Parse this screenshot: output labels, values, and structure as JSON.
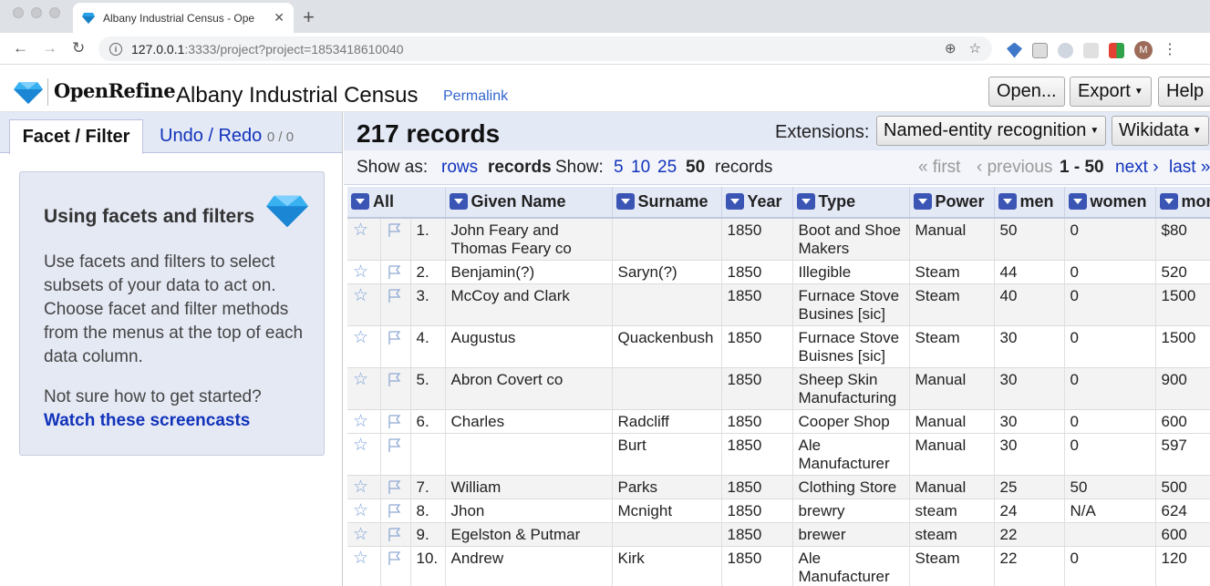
{
  "browser": {
    "tab_title": "Albany Industrial Census - Ope",
    "url_host": "127.0.0.1",
    "url_rest": ":3333/project?project=1853418610040",
    "avatar_letter": "M"
  },
  "header": {
    "logo": "OpenRefine",
    "project_title": "Albany Industrial Census",
    "permalink": "Permalink",
    "open_label": "Open...",
    "export_label": "Export",
    "help_label": "Help"
  },
  "left": {
    "tab_facet": "Facet / Filter",
    "tab_undo": "Undo / Redo",
    "undo_count": "0 / 0",
    "help_title": "Using facets and filters",
    "help_text": "Use facets and filters to select subsets of your data to act on. Choose facet and filter methods from the menus at the top of each data column.",
    "help_question": "Not sure how to get started?",
    "help_link": "Watch these screencasts"
  },
  "right": {
    "record_count": "217 records",
    "extensions_label": "Extensions:",
    "ext_ner": "Named-entity recognition",
    "ext_wikidata": "Wikidata",
    "show_as": "Show as:",
    "rows": "rows",
    "records": "records",
    "show": "Show:",
    "page_sizes": [
      "5",
      "10",
      "25",
      "50"
    ],
    "records_word": "records",
    "first": "« first",
    "previous": "‹ previous",
    "range": "1 - 50",
    "next": "next ›",
    "last": "last »"
  },
  "table": {
    "columns": [
      "All",
      "Given Name",
      "Surname",
      "Year",
      "Type",
      "Power",
      "men",
      "women",
      "mon"
    ],
    "rows": [
      {
        "idx": "1.",
        "given": "John Feary and Thomas Feary co",
        "surname": "",
        "year": "1850",
        "type": "Boot and Shoe Makers",
        "power": "Manual",
        "men": "50",
        "women": "0",
        "money": "$80"
      },
      {
        "idx": "2.",
        "given": "Benjamin(?)",
        "surname": "Saryn(?)",
        "year": "1850",
        "type": "Illegible",
        "power": "Steam",
        "men": "44",
        "women": "0",
        "money": "520"
      },
      {
        "idx": "3.",
        "given": "McCoy and Clark",
        "surname": "",
        "year": "1850",
        "type": "Furnace Stove Busines [sic]",
        "power": "Steam",
        "men": "40",
        "women": "0",
        "money": "1500"
      },
      {
        "idx": "4.",
        "given": "Augustus",
        "surname": "Quackenbush",
        "year": "1850",
        "type": "Furnace Stove Buisnes [sic]",
        "power": "Steam",
        "men": "30",
        "women": "0",
        "money": "1500"
      },
      {
        "idx": "5.",
        "given": "Abron Covert co",
        "surname": "",
        "year": "1850",
        "type": "Sheep Skin Manufacturing",
        "power": "Manual",
        "men": "30",
        "women": "0",
        "money": "900"
      },
      {
        "idx": "6.",
        "given": "Charles",
        "surname": "Radcliff",
        "year": "1850",
        "type": "Cooper Shop",
        "power": "Manual",
        "men": "30",
        "women": "0",
        "money": "600"
      },
      {
        "idx": "",
        "given": "",
        "surname": "Burt",
        "year": "1850",
        "type": "Ale Manufacturer",
        "power": "Manual",
        "men": "30",
        "women": "0",
        "money": "597"
      },
      {
        "idx": "7.",
        "given": "William",
        "surname": "Parks",
        "year": "1850",
        "type": "Clothing Store",
        "power": "Manual",
        "men": "25",
        "women": "50",
        "money": "500"
      },
      {
        "idx": "8.",
        "given": "Jhon",
        "surname": "Mcnight",
        "year": "1850",
        "type": "brewry",
        "power": "steam",
        "men": "24",
        "women": "N/A",
        "money": "624"
      },
      {
        "idx": "9.",
        "given": "Egelston & Putmar",
        "surname": "",
        "year": "1850",
        "type": "brewer",
        "power": "steam",
        "men": "22",
        "women": "",
        "money": "600"
      },
      {
        "idx": "10.",
        "given": "Andrew",
        "surname": "Kirk",
        "year": "1850",
        "type": "Ale Manufacturer",
        "power": "Steam",
        "men": "22",
        "women": "0",
        "money": "120"
      }
    ]
  },
  "colors": {
    "accent_blue": "#1133bb",
    "panel_bg": "#e4e9f6",
    "column_menu": "#3a55b4"
  }
}
